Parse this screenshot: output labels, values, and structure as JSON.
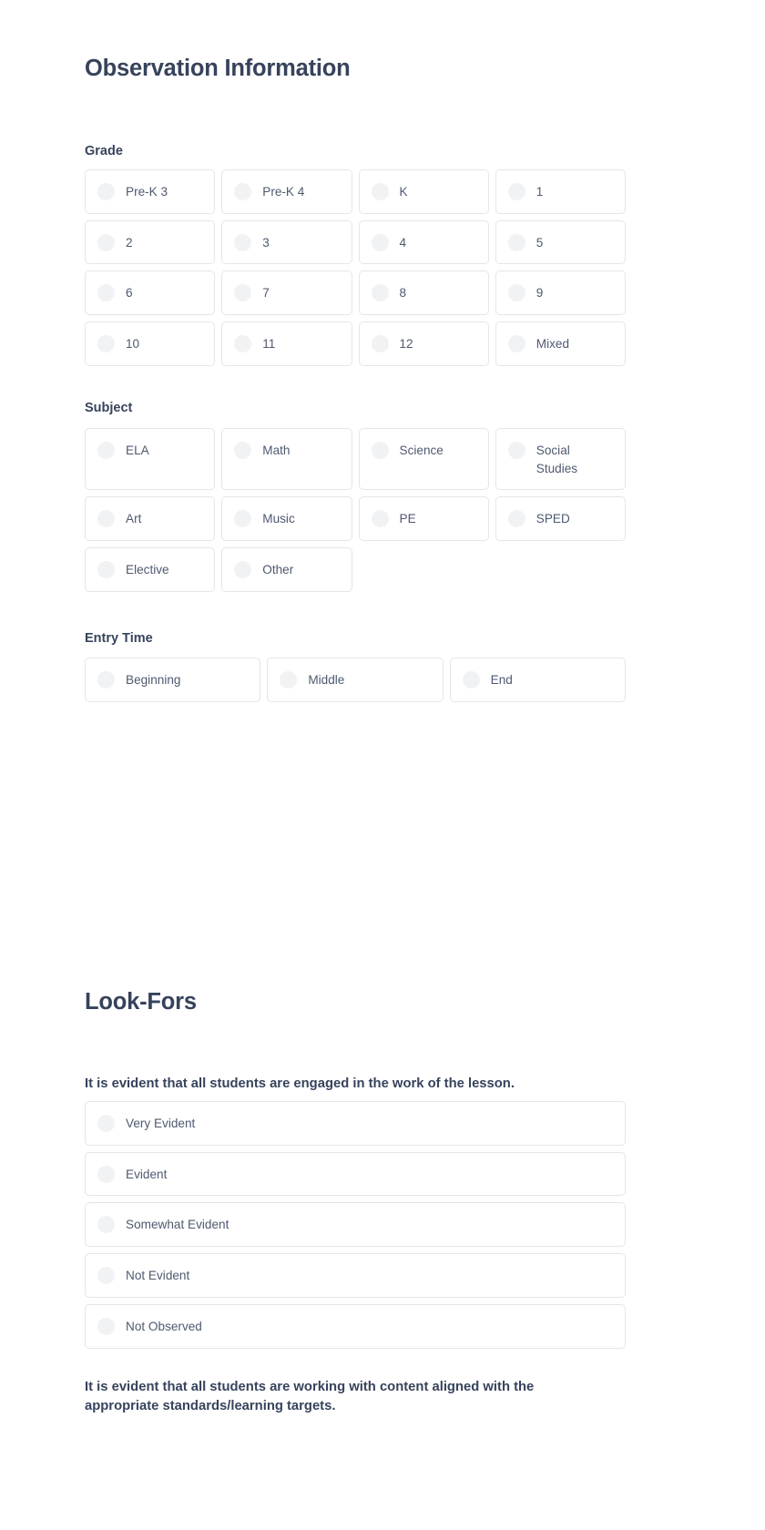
{
  "theme": {
    "background": "#ffffff",
    "heading_color": "#37435c",
    "label_color": "#4e596f",
    "card_border": "#e4e6ea",
    "radio_fill": "#f1f2f4"
  },
  "sections": {
    "observation": {
      "title": "Observation Information",
      "fields": {
        "grade": {
          "label": "Grade",
          "options": [
            "Pre-K 3",
            "Pre-K 4",
            "K",
            "1",
            "2",
            "3",
            "4",
            "5",
            "6",
            "7",
            "8",
            "9",
            "10",
            "11",
            "12",
            "Mixed"
          ]
        },
        "subject": {
          "label": "Subject",
          "options": [
            "ELA",
            "Math",
            "Science",
            "Social Studies",
            "Art",
            "Music",
            "PE",
            "SPED",
            "Elective",
            "Other"
          ]
        },
        "entry_time": {
          "label": "Entry Time",
          "options": [
            "Beginning",
            "Middle",
            "End"
          ]
        }
      }
    },
    "look_fors": {
      "title": "Look-Fors",
      "questions": [
        {
          "text": "It is evident that all students are engaged in the work of the lesson.",
          "options": [
            "Very Evident",
            "Evident",
            "Somewhat Evident",
            "Not Evident",
            "Not Observed"
          ]
        },
        {
          "text": "It is evident that all students are working with content aligned with the appropriate standards/learning targets.",
          "options": []
        }
      ]
    }
  }
}
